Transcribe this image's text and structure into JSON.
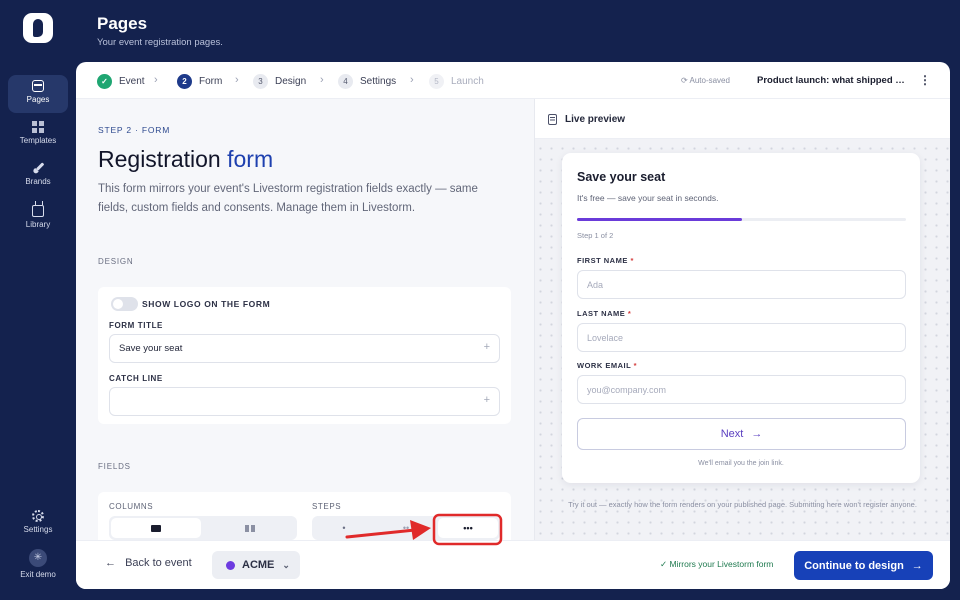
{
  "rail": {
    "items": [
      {
        "label": "Pages",
        "icon": "pages-icon"
      },
      {
        "label": "Templates",
        "icon": "templates-icon"
      },
      {
        "label": "Brands",
        "icon": "brush-icon"
      },
      {
        "label": "Library",
        "icon": "tv-icon"
      }
    ],
    "settings": "Settings",
    "exit": "Exit demo"
  },
  "header": {
    "title": "Pages",
    "subtitle": "Your event registration pages."
  },
  "stepper": {
    "steps": [
      {
        "num": "✓",
        "label": "Event",
        "state": "done"
      },
      {
        "num": "2",
        "label": "Form",
        "state": "active"
      },
      {
        "num": "3",
        "label": "Design",
        "state": "idle"
      },
      {
        "num": "4",
        "label": "Settings",
        "state": "idle"
      },
      {
        "num": "5",
        "label": "Launch",
        "state": "disabled"
      }
    ],
    "autosaved": "Auto-saved",
    "doc_name": "Product launch: what shipped this quarter"
  },
  "editor": {
    "eyebrow": "STEP 2 · FORM",
    "title_main": "Registration ",
    "title_accent": "form",
    "description": "This form mirrors your event's Livestorm registration fields exactly — same fields, custom fields and consents. Manage them in Livestorm.",
    "design_label": "DESIGN",
    "show_logo_label": "SHOW LOGO ON THE FORM",
    "form_title_label": "FORM TITLE",
    "form_title_value": "Save your seat",
    "catch_line_label": "CATCH LINE",
    "catch_line_value": "",
    "fields_label": "FIELDS",
    "columns_label": "COLUMNS",
    "steps_label": "STEPS",
    "steps_options": [
      "•",
      "••",
      "•••"
    ]
  },
  "footer": {
    "back": "Back to event",
    "brand": "ACME",
    "brand_color": "#6d3be0",
    "mirrors": "Mirrors your Livestorm form",
    "cta": "Continue to design"
  },
  "preview": {
    "title": "Live preview",
    "form_title": "Save your seat",
    "form_sub": "It's free — save your seat in seconds.",
    "progress": 0.5,
    "step_text": "Step 1 of 2",
    "fields": [
      {
        "label": "FIRST NAME",
        "placeholder": "Ada"
      },
      {
        "label": "LAST NAME",
        "placeholder": "Lovelace"
      },
      {
        "label": "WORK EMAIL",
        "placeholder": "you@company.com"
      }
    ],
    "required_mark": "*",
    "next": "Next",
    "note": "We'll email you the join link.",
    "try_text": "Try it out — exactly how the form renders on your published page. Submitting here won't register anyone."
  },
  "colors": {
    "navy": "#14224e",
    "primary": "#1741b8",
    "accent_purple": "#6a3bd9",
    "annotation_red": "#e02a2a"
  }
}
